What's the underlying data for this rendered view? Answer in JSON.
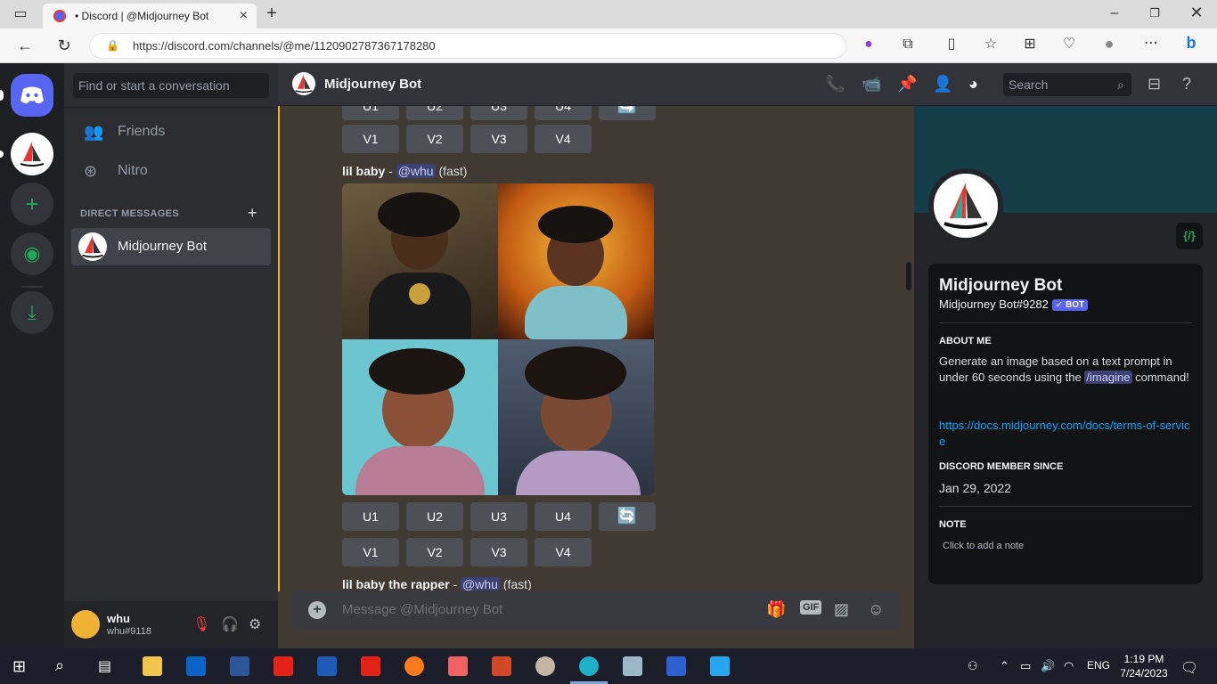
{
  "browser": {
    "tab_title": "• Discord | @Midjourney Bot",
    "url": "https://discord.com/channels/@me/1120902787367178280"
  },
  "sidebar": {
    "search_placeholder": "Find or start a conversation",
    "friends_label": "Friends",
    "nitro_label": "Nitro",
    "direct_messages_label": "DIRECT MESSAGES",
    "dm_name": "Midjourney Bot"
  },
  "user": {
    "name": "whu",
    "tag": "whu#9118"
  },
  "header": {
    "channel_name": "Midjourney Bot",
    "search_placeholder": "Search"
  },
  "chat": {
    "upscale_buttons": [
      "U1",
      "U2",
      "U3",
      "U4"
    ],
    "variation_buttons": [
      "V1",
      "V2",
      "V3",
      "V4"
    ],
    "message1": {
      "prompt": "lil baby",
      "separator": " - ",
      "mention": "@whu",
      "mode": "(fast)"
    },
    "message2": {
      "prompt": "lil baby the rapper",
      "separator": " - ",
      "mention": "@whu",
      "mode": "(fast)"
    },
    "composer_placeholder": "Message @Midjourney Bot",
    "gif_label": "GIF"
  },
  "profile": {
    "name": "Midjourney Bot",
    "tag": "Midjourney Bot#9282",
    "bot_badge": "✓ BOT",
    "dev_badge": "{/}",
    "about_title": "ABOUT ME",
    "about_text_1": "Generate an image based on a text prompt in under 60 seconds using the",
    "about_command": "/imagine",
    "about_text_2": "command!",
    "link": "https://docs.midjourney.com/docs/terms-of-service",
    "member_since_title": "DISCORD MEMBER SINCE",
    "member_since": "Jan 29, 2022",
    "note_title": "NOTE",
    "note_placeholder": "Click to add a note"
  },
  "taskbar": {
    "language": "ENG",
    "time": "1:19 PM",
    "date": "7/24/2023"
  },
  "colors": {
    "discord_blurple": "#5865f2",
    "accent_yellow": "#f0b232",
    "link_blue": "#00a8fc"
  }
}
